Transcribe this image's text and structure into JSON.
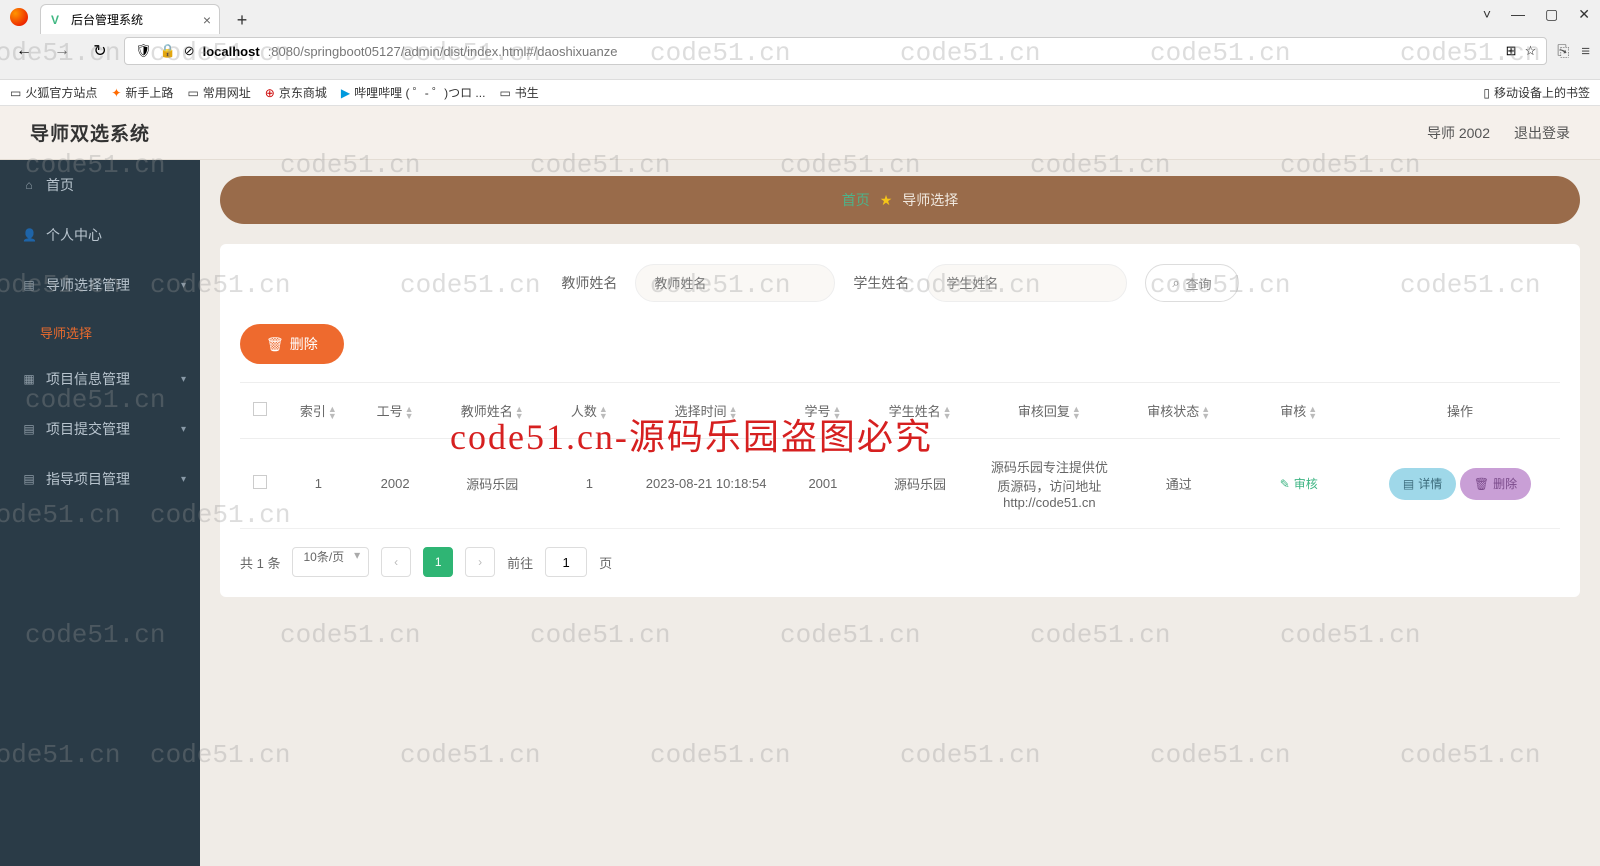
{
  "browser": {
    "tab_title": "后台管理系统",
    "new_tab": "+",
    "win": {
      "min": "—",
      "max": "▢",
      "close": "✕",
      "drop": "˅"
    },
    "nav": {
      "back": "←",
      "fwd": "→",
      "reload": "↻"
    },
    "url_host": "localhost",
    "url_path": ":8080/springboot05127/admin/dist/index.html#/daoshixuanze",
    "bookmarks": [
      "火狐官方站点",
      "新手上路",
      "常用网址",
      "京东商城",
      "哔哩哔哩 ( ゜- ゜)つロ ...",
      "书生"
    ],
    "bm_right": "移动设备上的书签"
  },
  "app": {
    "brand": "导师双选系统",
    "user": "导师 2002",
    "logout": "退出登录",
    "sidebar": [
      {
        "icon": "⌂",
        "label": "首页"
      },
      {
        "icon": "👤",
        "label": "个人中心"
      },
      {
        "icon": "▤",
        "label": "导师选择管理",
        "expand": true
      },
      {
        "icon": "",
        "label": "导师选择",
        "sub": true
      },
      {
        "icon": "▦",
        "label": "项目信息管理",
        "expand": true
      },
      {
        "icon": "▤",
        "label": "项目提交管理",
        "expand": true
      },
      {
        "icon": "▤",
        "label": "指导项目管理",
        "expand": true
      }
    ],
    "crumb": {
      "home": "首页",
      "current": "导师选择"
    },
    "search": {
      "teacher_label": "教师姓名",
      "teacher_ph": "教师姓名",
      "student_label": "学生姓名",
      "student_ph": "学生姓名",
      "query": "查询"
    },
    "delete_btn": "删除",
    "columns": [
      "",
      "索引",
      "工号",
      "教师姓名",
      "人数",
      "选择时间",
      "学号",
      "学生姓名",
      "审核回复",
      "审核状态",
      "审核",
      "操作"
    ],
    "row": {
      "index": "1",
      "gonghao": "2002",
      "teacher": "源码乐园",
      "count": "1",
      "time": "2023-08-21 10:18:54",
      "xuehao": "2001",
      "student": "源码乐园",
      "reply": "源码乐园专注提供优质源码，访问地址http://code51.cn",
      "status": "通过",
      "audit_btn": "审核",
      "detail_btn": "详情",
      "del_btn": "删除"
    },
    "pager": {
      "total": "共 1 条",
      "size": "10条/页",
      "cur": "1",
      "goto_pre": "前往",
      "goto_val": "1",
      "goto_suf": "页"
    }
  },
  "watermark": "code51.cn",
  "watermark_big": "code51.cn-源码乐园盗图必究"
}
